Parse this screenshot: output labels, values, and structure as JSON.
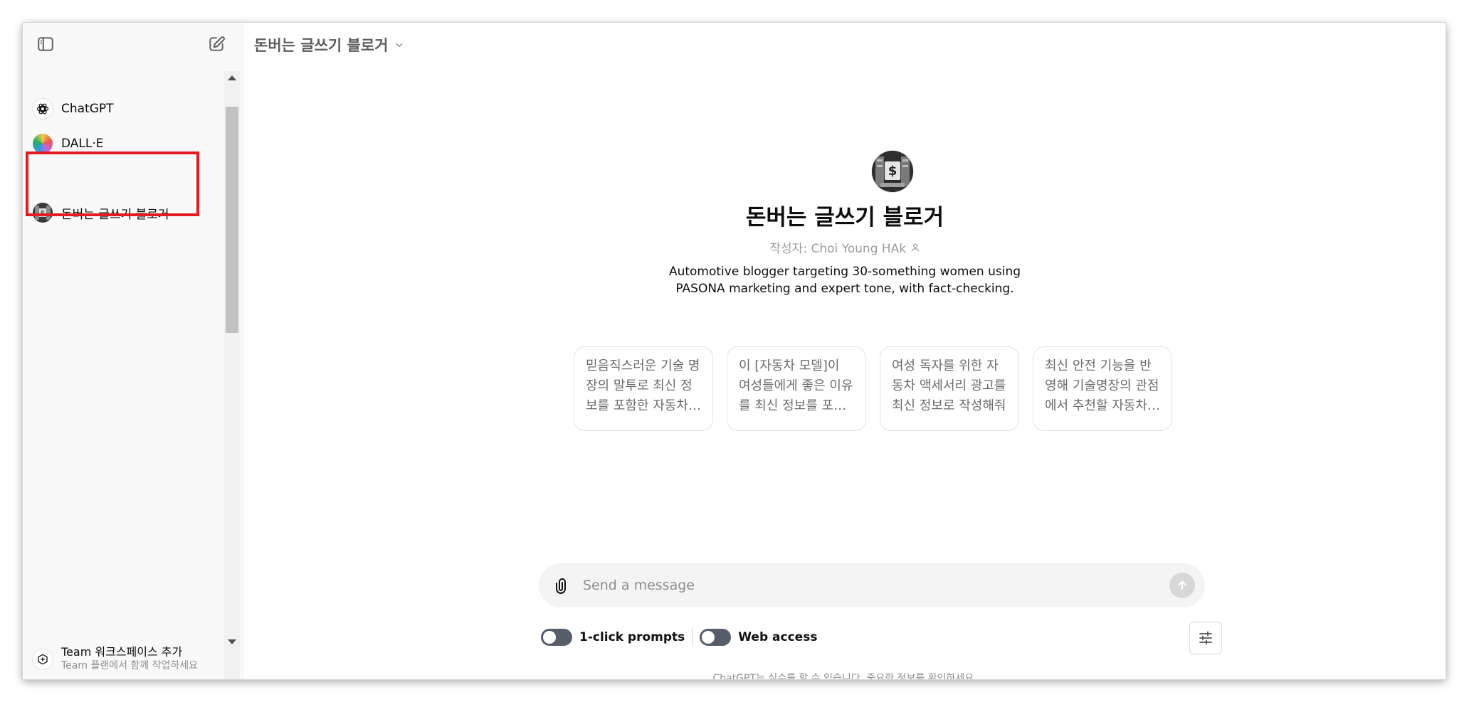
{
  "sidebar": {
    "toggle_icon": "sidebar-toggle-icon",
    "new_chat_icon": "new-chat-icon",
    "items": [
      {
        "label": "ChatGPT",
        "icon": "openai-logo-icon"
      },
      {
        "label": "DALL·E",
        "icon": "dalle-logo-icon"
      },
      {
        "label": "돈버는 글쓰기 블로거",
        "icon": "gpt-avatar",
        "highlighted": true
      }
    ],
    "team": {
      "title": "Team 워크스페이스 추가",
      "subtitle": "Team 플랜에서 함께 작업하세요",
      "icon": "team-add-icon"
    }
  },
  "header": {
    "model_title": "돈버는 글쓰기 블로거",
    "dropdown_icon": "chevron-down-icon"
  },
  "gpt": {
    "name": "돈버는 글쓰기 블로거",
    "author": "작성자: Choi Young HAk",
    "author_icon": "person-icon",
    "description": "Automotive blogger targeting 30-something women using PASONA marketing and expert tone, with fact-checking."
  },
  "starters": [
    "믿음직스러운 기술 명장의 말투로 최신 정보를 포함한 자동차 관련 글을 써줘",
    "이 [자동차 모델]이 여성들에게 좋은 이유를 최신 정보를 포함해 알려줘",
    "여성 독자를 위한 자동차 액세서리 광고를 최신 정보로 작성해줘",
    "최신 안전 기능을 반영해 기술명장의 관점에서 추천할 자동차를 알려줘"
  ],
  "composer": {
    "placeholder": "Send a message",
    "attach_icon": "paperclip-icon",
    "send_icon": "arrow-up-icon"
  },
  "toggles": [
    {
      "label": "1-click prompts",
      "on": false
    },
    {
      "label": "Web access",
      "on": false
    }
  ],
  "settings_icon": "sliders-icon",
  "disclaimer": "ChatGPT는 실수를 할 수 있습니다. 중요한 정보를 확인하세요.",
  "colors": {
    "highlight": "#e31c23",
    "toggle_track": "#575d6b",
    "sidebar_bg": "#f9f9f9",
    "composer_bg": "#f4f4f4"
  }
}
